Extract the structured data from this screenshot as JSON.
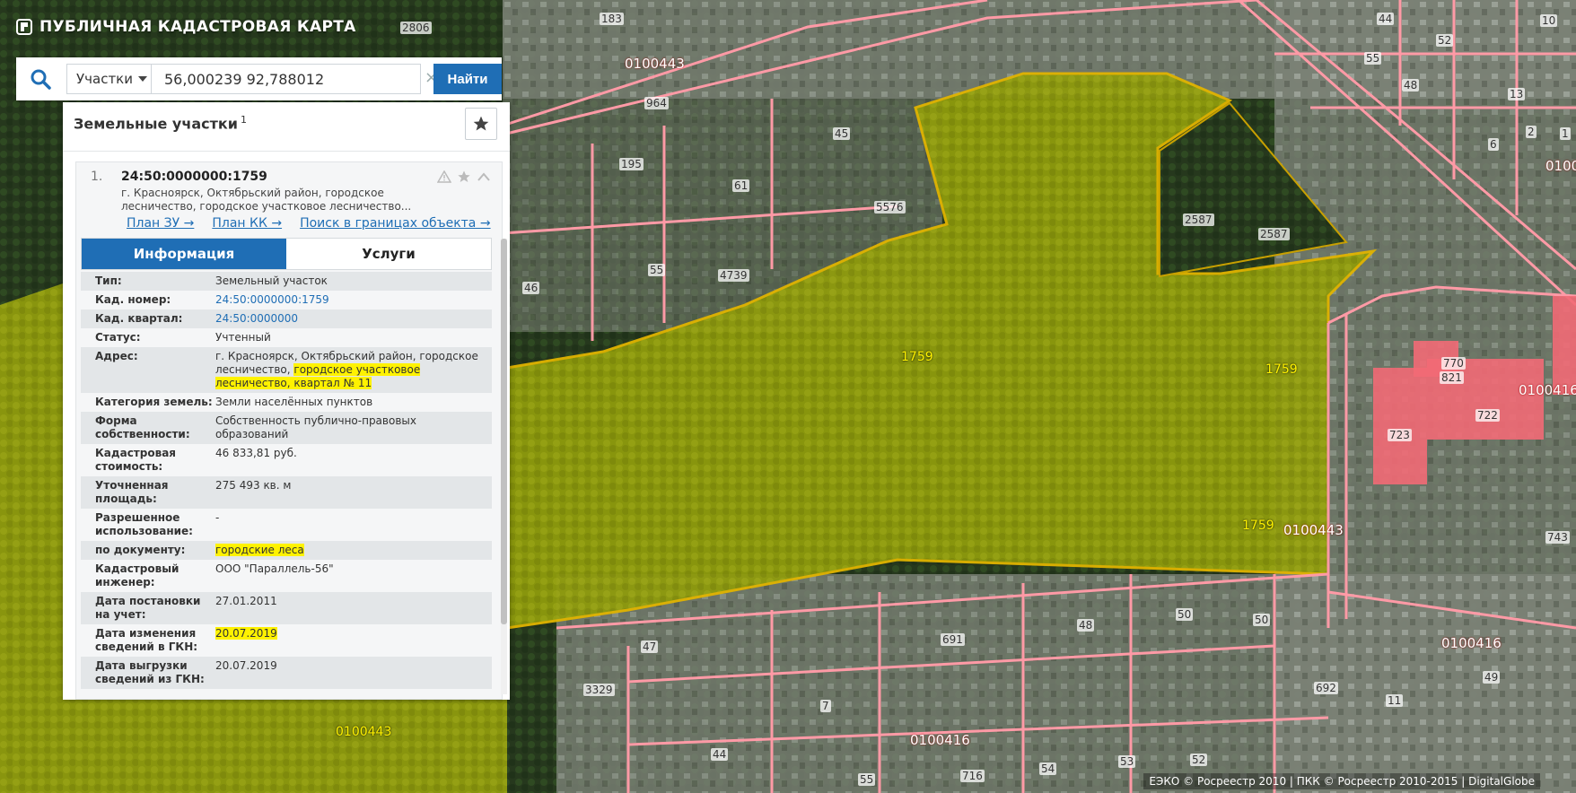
{
  "app": {
    "title": "ПУБЛИЧНАЯ КАДАСТРОВАЯ КАРТА"
  },
  "search": {
    "type_label": "Участки",
    "query": "56,000239 92,788012",
    "clear_symbol": "×",
    "find_label": "Найти"
  },
  "panel": {
    "title": "Земельные участки",
    "count": "1",
    "result": {
      "index": "1.",
      "cad_number": "24:50:0000000:1759",
      "address_short": "г. Красноярск, Октябрьский район, городское лесничество, городское участковое лесничество...",
      "links": [
        "План ЗУ →",
        "План КК →",
        "Поиск в границах объекта →"
      ],
      "tabs": [
        "Информация",
        "Услуги"
      ],
      "info": [
        {
          "k": "Тип:",
          "v": "Земельный участок"
        },
        {
          "k": "Кад. номер:",
          "v": "24:50:0000000:1759"
        },
        {
          "k": "Кад. квартал:",
          "v": "24:50:0000000"
        },
        {
          "k": "Статус:",
          "v": "Учтенный"
        },
        {
          "k": "Адрес:",
          "v": "г. Красноярск, Октябрьский район, городское лесничество, ",
          "v_hl": "городское участковое лесничество, квартал № 11"
        },
        {
          "k": "Категория земель:",
          "v": "Земли населённых пунктов"
        },
        {
          "k": "Форма собственности:",
          "v": "Собственность публично-правовых образований"
        },
        {
          "k": "Кадастровая стоимость:",
          "v": "46 833,81 руб."
        },
        {
          "k": "Уточненная площадь:",
          "v": "275 493 кв. м"
        },
        {
          "k": "Разрешенное использование:",
          "v": "-"
        },
        {
          "k": "по документу:",
          "v": "",
          "v_hl": "городские леса"
        },
        {
          "k": "Кадастровый инженер:",
          "v": "ООО \"Параллель-56\""
        },
        {
          "k": "Дата постановки на учет:",
          "v": "27.01.2011"
        },
        {
          "k": "Дата изменения сведений в ГКН:",
          "v": "",
          "v_hl": "20.07.2019"
        },
        {
          "k": "Дата выгрузки сведений из ГКН:",
          "v": "20.07.2019"
        }
      ]
    }
  },
  "map": {
    "labels": [
      "183",
      "964",
      "0100443",
      "45",
      "61",
      "5576",
      "195",
      "55",
      "46",
      "4739",
      "2587",
      "2587",
      "1759",
      "1759",
      "1759",
      "0100443",
      "0100416",
      "770",
      "821",
      "722",
      "723",
      "0100416",
      "691",
      "48",
      "50",
      "50",
      "692",
      "3329",
      "7",
      "44",
      "0100416",
      "55",
      "716",
      "54",
      "53",
      "52",
      "0100443",
      "2806",
      "52",
      "55",
      "48",
      "13",
      "6",
      "2",
      "1",
      "743",
      "49",
      "11",
      "10",
      "0100",
      "44",
      "47"
    ],
    "credits": "ЕЭКО © Росреестр 2010 | ПКК © Росреестр 2010-2015 | DigitalGlobe"
  }
}
